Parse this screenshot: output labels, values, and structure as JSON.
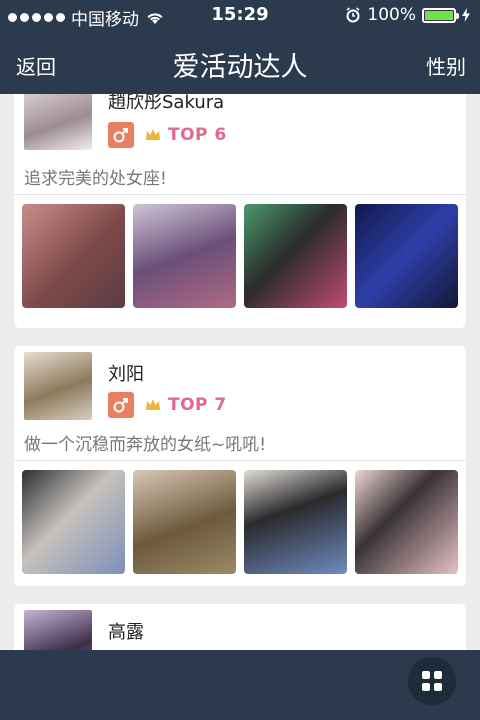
{
  "status_bar": {
    "carrier": "中国移动",
    "time": "15:29",
    "battery": "100%"
  },
  "nav": {
    "back_label": "返回",
    "title": "爱活动达人",
    "gender_filter_label": "性别"
  },
  "users": [
    {
      "name": "趙欣彤Sakura",
      "rank": "TOP 6",
      "motto": "追求完美的处女座!",
      "avatar_color": "#c9b9bd",
      "photo_colors": [
        "#9a5f5e",
        "#6b4f7a",
        "#3e6b5c",
        "#1d2a6e"
      ]
    },
    {
      "name": "刘阳",
      "rank": "TOP 7",
      "motto": "做一个沉稳而奔放的女纸~吼吼!",
      "avatar_color": "#b7a48f",
      "photo_colors": [
        "#d7cfc8",
        "#8a7a5e",
        "#7f93b3",
        "#c9a9a7"
      ]
    },
    {
      "name": "高露",
      "avatar_color": "#6c5f7c"
    }
  ],
  "colors": {
    "nav_bg": "#2c3a4d",
    "gender_badge": "#e78062",
    "rank_text": "#e06a8a",
    "crown": "#e6b73a"
  }
}
